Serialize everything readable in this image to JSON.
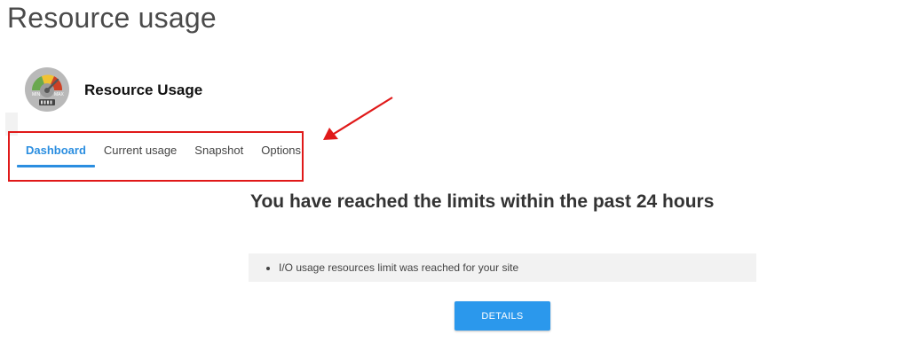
{
  "page": {
    "title": "Resource usage"
  },
  "app": {
    "name": "Resource Usage",
    "icon": "gauge-icon",
    "gauge_labels": {
      "min": "MIN",
      "max": "MAX"
    }
  },
  "tabs": [
    {
      "label": "Dashboard",
      "active": true
    },
    {
      "label": "Current usage",
      "active": false
    },
    {
      "label": "Snapshot",
      "active": false
    },
    {
      "label": "Options",
      "active": false
    }
  ],
  "main": {
    "headline": "You have reached the limits within the past 24 hours",
    "alerts": [
      "I/O usage resources limit was reached for your site"
    ],
    "details_label": "DETAILS"
  },
  "colors": {
    "accent": "#2b8ee0",
    "button": "#2b98ec",
    "annotation": "#e01919",
    "panel": "#f2f2f2"
  }
}
